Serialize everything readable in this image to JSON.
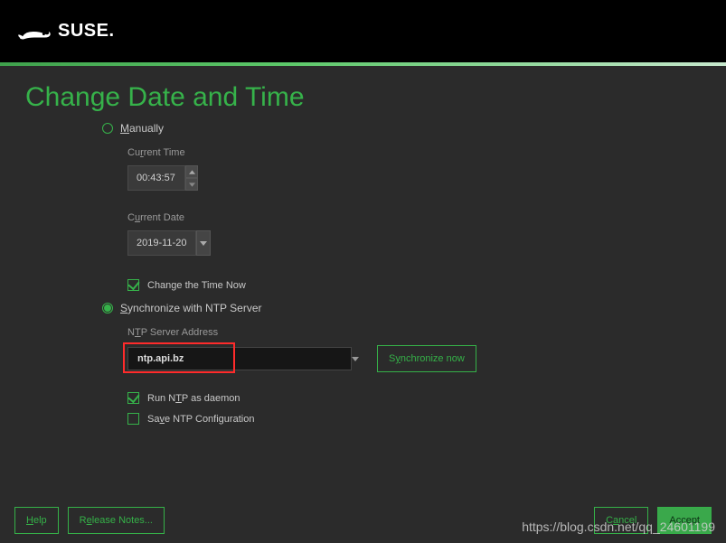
{
  "brand": "SUSE.",
  "title": "Change Date and Time",
  "manual": {
    "label": "Manually",
    "selected": false
  },
  "current_time": {
    "label": "Current Time",
    "value": "00:43:57"
  },
  "current_date": {
    "label": "Current Date",
    "value": "2019-11-20"
  },
  "change_now": {
    "label": "Change the Time Now",
    "checked": true
  },
  "sync": {
    "label": "Synchronize with NTP Server",
    "selected": true
  },
  "ntp": {
    "label": "NTP Server Address",
    "value": "ntp.api.bz"
  },
  "sync_btn": "Synchronize now",
  "run_daemon": {
    "label": "Run NTP as daemon",
    "checked": true
  },
  "save_conf": {
    "label": "Save NTP Configuration",
    "checked": false
  },
  "footer": {
    "help": "Help",
    "release": "Release Notes...",
    "cancel": "Cancel",
    "accept": "Accept"
  },
  "watermark": "https://blog.csdn.net/qq_24601199"
}
